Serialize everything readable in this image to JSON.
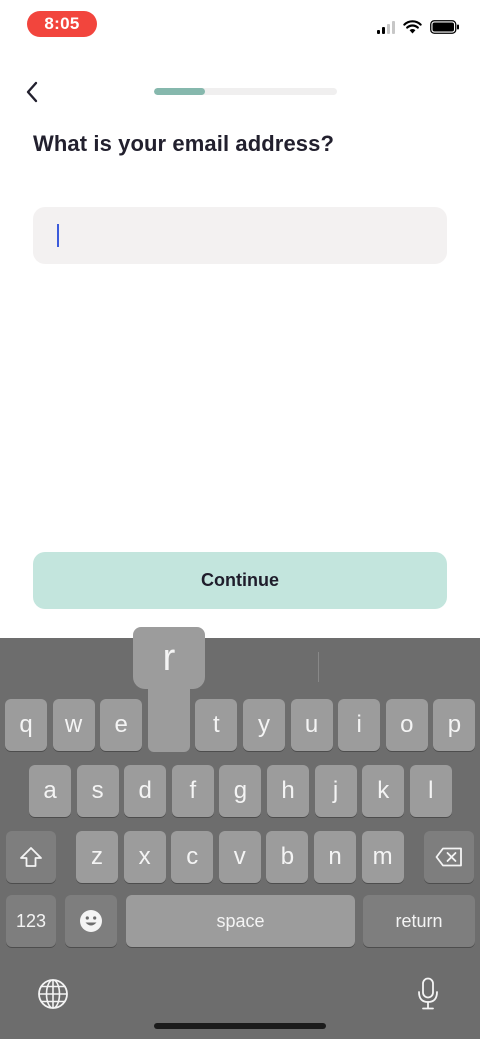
{
  "status_bar": {
    "time": "8:05",
    "signal_icon": "cellular-signal-icon",
    "wifi_icon": "wifi-icon",
    "battery_icon": "battery-icon"
  },
  "header": {
    "back_icon": "chevron-left-icon",
    "progress_fraction": 0.28
  },
  "page": {
    "title": "What is your email address?"
  },
  "email_field": {
    "value": "",
    "caret_visible": true
  },
  "continue_button": {
    "label": "Continue",
    "color": "#c3e5dd"
  },
  "keyboard": {
    "row1": [
      "q",
      "w",
      "e",
      "r",
      "t",
      "y",
      "u",
      "i",
      "o",
      "p"
    ],
    "row2": [
      "a",
      "s",
      "d",
      "f",
      "g",
      "h",
      "j",
      "k",
      "l"
    ],
    "row3": [
      "z",
      "x",
      "c",
      "v",
      "b",
      "n",
      "m"
    ],
    "popup_key": "r",
    "numbers_label": "123",
    "space_label": "space",
    "return_label": "return",
    "shift_icon": "shift-icon",
    "delete_icon": "backspace-icon",
    "emoji_icon": "emoji-icon",
    "globe_icon": "globe-icon",
    "mic_icon": "microphone-icon"
  }
}
